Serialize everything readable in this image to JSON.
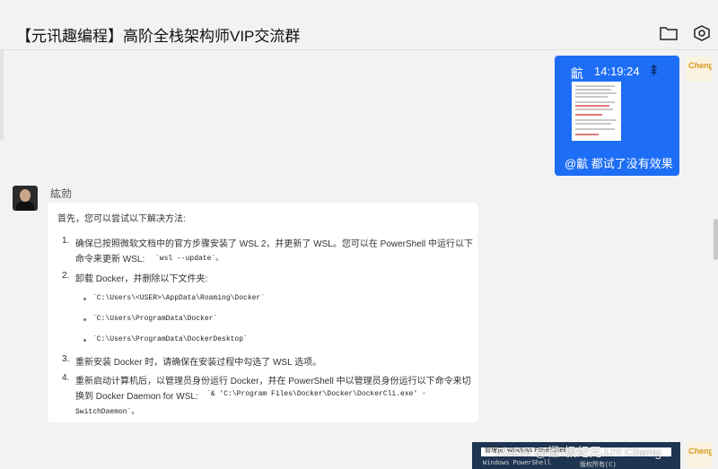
{
  "header": {
    "title": "【元讯趣编程】高阶全栈架构师VIP交流群"
  },
  "outgoing_image_message": {
    "icon_glyph": "䶳",
    "time": "14:19:24",
    "up_glyph": "⇞",
    "caption": "@䶳 都试了没有效果"
  },
  "incoming_message": {
    "sender": "紘勍",
    "intro": "首先，您可以尝试以下解决方法:",
    "step1_num": "1.",
    "step1_line1": "确保已按照微软文档中的官方步骤安装了 WSL 2，并更新了 WSL。您可以在 PowerShell 中运行以下",
    "step1_line2_text": "命令来更新 WSL:",
    "step1_code": "`wsl --update`。",
    "step2_num": "2.",
    "step2_text": "卸载 Docker，并删除以下文件夹:",
    "folders": [
      "`C:\\Users\\<USER>\\AppData\\Roaming\\Docker`",
      "`C:\\Users\\ProgramData\\Docker`",
      "`C:\\Users\\ProgramData\\DockerDesktop`"
    ],
    "step3_num": "3.",
    "step3_text": "重新安装 Docker 时，请确保在安装过程中勾选了 WSL 选项。",
    "step4_num": "4.",
    "step4_line1": "重新启动计算机后，以管理员身份运行 Docker，并在 PowerShell 中以管理员身份运行以下命令来切",
    "step4_line2_text": "换到 Docker Daemon for WSL:",
    "step4_code1": "`& 'C:\\Program Files\\Docker\\Docker\\DockerCli.exe' -",
    "step4_code2": "SwitchDaemon`。"
  },
  "powershell_screenshot": {
    "window_title": "管理员: Windows PowerShell",
    "line1": "Windows PowerShell",
    "line2": "版权所有(C)"
  },
  "watermark": "CSDN @橙-极纪元JJY.Cheng",
  "avatar_label": "Cheng"
}
